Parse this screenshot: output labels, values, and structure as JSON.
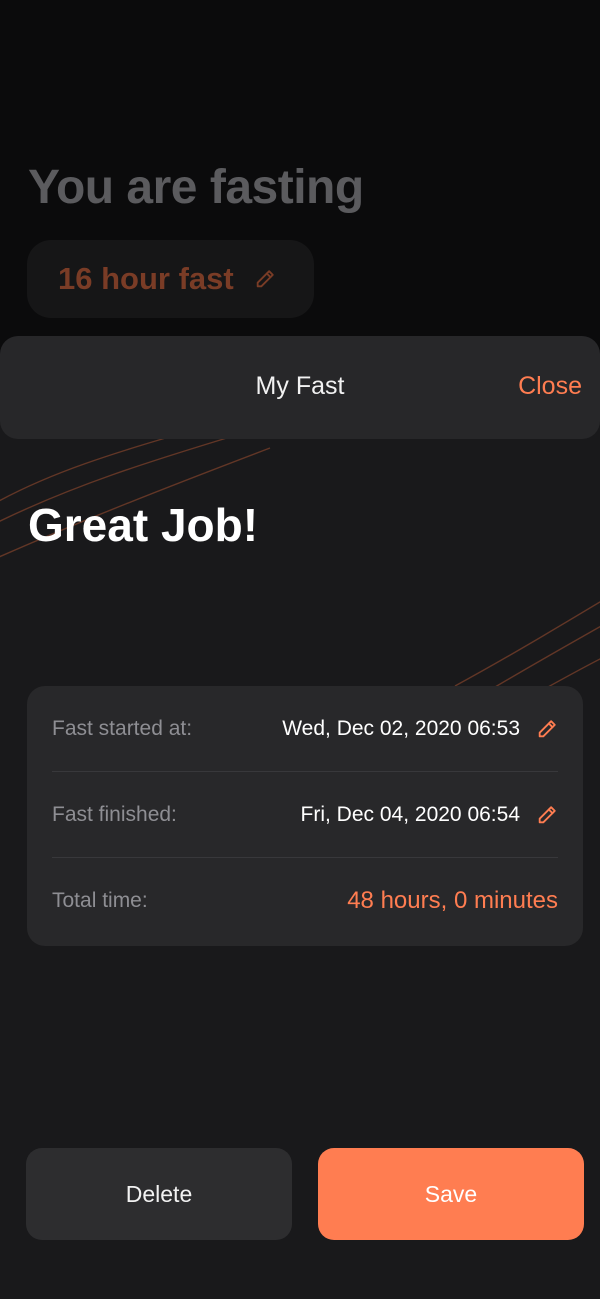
{
  "background": {
    "title": "You are fasting",
    "plan_label": "16 hour fast",
    "plan_edit_icon": "pencil-icon"
  },
  "sheet": {
    "title": "My Fast",
    "close_label": "Close",
    "heading": "Great Job!",
    "details": {
      "started": {
        "label": "Fast started at:",
        "value": "Wed, Dec 02, 2020 06:53",
        "icon": "pencil-icon"
      },
      "finished": {
        "label": "Fast finished:",
        "value": "Fri, Dec 04, 2020 06:54",
        "icon": "pencil-icon"
      },
      "total": {
        "label": "Total time:",
        "value": "48 hours, 0 minutes"
      }
    },
    "delete_label": "Delete",
    "save_label": "Save"
  },
  "colors": {
    "accent": "#ff7d51",
    "sheet_bg": "#19191b",
    "card_bg": "#28282a",
    "header_bg": "#272729",
    "muted_text": "#8e8e93"
  }
}
